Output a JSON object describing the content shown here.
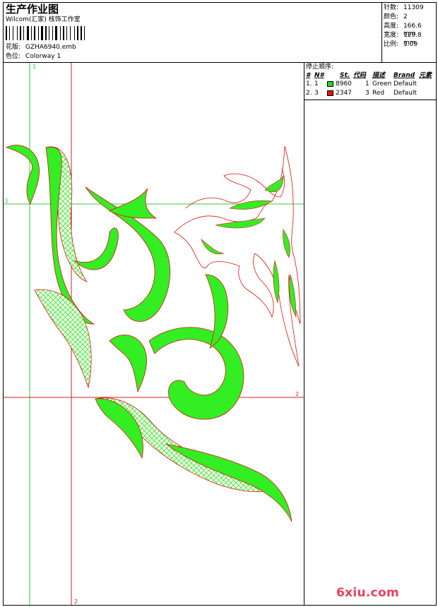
{
  "header": {
    "title": "生产作业图",
    "company": "Wilcom(汇家) 核饰工作室",
    "design_label": "花版:",
    "design_value": "GZHA6940.emb",
    "colorway_label": "色位:",
    "colorway_value": "Colorway 1"
  },
  "stats": [
    {
      "label": "针数:",
      "value": "11309"
    },
    {
      "label": "颜色:",
      "value": "2"
    },
    {
      "label": "高度:",
      "value": "166.6 mm"
    },
    {
      "label": "宽度:",
      "value": "129.8 mm"
    },
    {
      "label": "比例:",
      "value": "1.09"
    }
  ],
  "stop_panel": {
    "title": "停止顺序:",
    "columns": [
      "#",
      "N#",
      "St.",
      "代码",
      "描述",
      "Brand",
      "元素"
    ],
    "rows": [
      {
        "index": "1.",
        "n": "1",
        "swatch": "#22dd22",
        "stitches": "8960",
        "code": "1",
        "desc": "Green",
        "brand": "Default"
      },
      {
        "index": "2.",
        "n": "3",
        "swatch": "#ee1111",
        "stitches": "2347",
        "code": "3",
        "desc": "Red",
        "brand": "Default"
      }
    ]
  },
  "guides": {
    "v1": "1",
    "h1": "1",
    "h2": "2",
    "v2": "2"
  },
  "colors": {
    "green": "#33ee22",
    "red": "#dd1111",
    "guide_green": "#33cc33",
    "guide_red": "#cc2222"
  },
  "watermark": {
    "text": "6xiu.com"
  }
}
